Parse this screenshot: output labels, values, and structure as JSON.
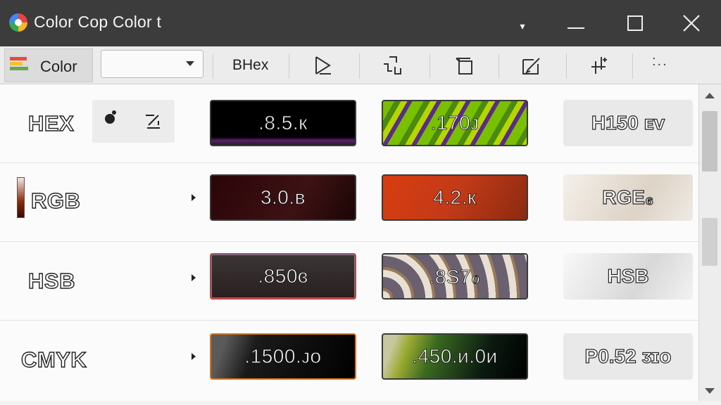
{
  "window": {
    "title": "Color Cop Color t"
  },
  "toolbar": {
    "color_label": "Color",
    "dropdown_value": "",
    "format_label": "BHex",
    "more_label": ":.."
  },
  "rows": [
    {
      "label": "HEX",
      "values": [
        ".8.5.к",
        ".170ᴊ",
        "H150 ᴇᴠ"
      ]
    },
    {
      "label": "RGB",
      "values": [
        "3.0.в",
        "4.2.к",
        "RGE₆"
      ]
    },
    {
      "label": "HSB",
      "values": [
        ".850ɞ",
        ".8S7ℴ",
        "HSB"
      ]
    },
    {
      "label": "CMYK",
      "values": [
        ".1500.ᴊo",
        ".450.ᴎ.0ᴎ",
        "P0.52 ᴣɪo"
      ]
    }
  ],
  "colors": {
    "titlebar": "#3c3c3c",
    "toolbar": "#ececec",
    "content": "#fbfbfb"
  }
}
